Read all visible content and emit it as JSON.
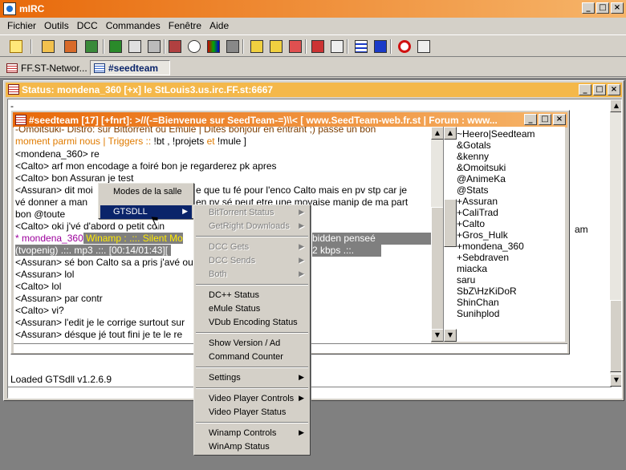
{
  "window": {
    "title": "mIRC"
  },
  "menubar": [
    "Fichier",
    "Outils",
    "DCC",
    "Commandes",
    "Fenêtre",
    "Aide"
  ],
  "switchbar": {
    "tabs": [
      "FF.ST-Networ...",
      "#seedteam"
    ]
  },
  "status_window": {
    "title": "Status: mondena_360 [+x] le StLouis3.us.irc.FF.st:6667",
    "first_line": "-",
    "loaded": "Loaded GTSdll v1.2.6.9",
    "partial_right": "am"
  },
  "channel_window": {
    "title": "#seedteam [17] [+fnrt]: >//(-=Bienvenue sur SeedTeam-=)\\\\< [ www.SeedTeam-web.fr.st | Forum : www...",
    "lines": {
      "l1": "-Omoitsuki- Distro: sur Bittorrent ou Emule | Dites bonjour en entrant ;)  passe un bon",
      "l2a": " moment parmi nous | ",
      "l2b": "Triggers :: ",
      "l2c": "!bt ,  !projets ",
      "l2d": "et",
      "l2e": " !mule ]",
      "l3": "<mondena_360> re",
      "l4": "<Calto> arf mon encodage a foiré bon je regarderez pk apres",
      "l5": "<Calto> bon Assuran je test",
      "l6a": "<Assuran> dit moi",
      "l6b": "e que tu fé pour l'enco Calto mais en pv stp car je",
      "l7a": " vé donner a man",
      "l7b": "en pv sé peut etre une movaise manip de ma part",
      "l8": " bon @toute",
      "l9a": "<Calto> oki j'vé d'abord o petit coin",
      "l10a": "* mondena_360",
      "l10b": " Winamp : .::. Silent Mo",
      "l10c": "bidden penseé",
      "l11a": " (tvopenig) .::. mp3 .::. [00:14/01:43][",
      "l11b": "2 kbps .::.",
      "l12a": "<Assuran> sé bon Calto sa a pris j'avé ou",
      "l13": "<Assuran> lol",
      "l14": "<Calto> lol",
      "l15": "<Assuran> par contr",
      "l16": "<Calto> vi?",
      "l17a": "<Assuran> l'edit je le corrige surtout sur",
      "l18a": "<Assuran> désque jé tout fini je te le re"
    },
    "nicks": [
      "~Heero|Seedteam",
      "&Gotals",
      "&kenny",
      "&Omoitsuki",
      "@AnimeKa",
      "@Stats",
      "+Assuran",
      "+CaliTrad",
      "+Calto",
      "+Gros_Hulk",
      "+mondena_360",
      "+Sebdraven",
      "miacka",
      "saru",
      "SbZ\\HzKiDoR",
      "ShinChan",
      "Sunihplod"
    ]
  },
  "context_menu": {
    "items": [
      "Modes de la salle",
      "GTSDLL"
    ]
  },
  "submenu": {
    "bittorrent_status": "BitTorrent Status",
    "getright_downloads": "GetRight Downloads",
    "dcc_gets": "DCC Gets",
    "dcc_sends": "DCC Sends",
    "both": "Both",
    "dcpp_status": "DC++ Status",
    "emule_status": "eMule Status",
    "vdub_status": "VDub Encoding Status",
    "show_version": "Show Version / Ad",
    "command_counter": "Command Counter",
    "settings": "Settings",
    "video_player_controls": "Video Player Controls",
    "video_player_status": "Video Player Status",
    "winamp_controls": "Winamp Controls",
    "winamp_status": "WinAmp Status"
  },
  "icons": {
    "arrow_right": "▶",
    "scroll_up": "▲",
    "scroll_down": "▼",
    "minimize": "_",
    "maximize": "□",
    "close": "×"
  },
  "colors": {
    "titlebar": "#e8690a",
    "menu_highlight": "#0a246a",
    "status_titlebar": "#f4b84a"
  }
}
